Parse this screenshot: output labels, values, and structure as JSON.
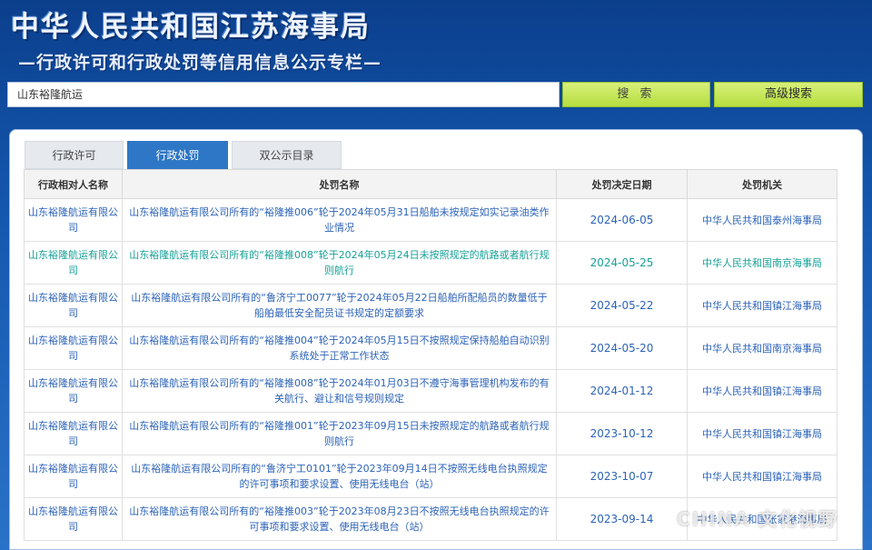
{
  "header": {
    "title": "中华人民共和国江苏海事局",
    "subtitle": "—行政许可和行政处罚等信用信息公示专栏—"
  },
  "search": {
    "value": "山东裕隆航运",
    "search_label": "搜 索",
    "advanced_label": "高级搜索"
  },
  "tabs": [
    {
      "label": "行政许可"
    },
    {
      "label": "行政处罚"
    },
    {
      "label": "双公示目录"
    }
  ],
  "table": {
    "headers": [
      "行政相对人名称",
      "处罚名称",
      "处罚决定日期",
      "处罚机关"
    ],
    "rows": [
      {
        "party": "山东裕隆航运有限公司",
        "name": "山东裕隆航运有限公司所有的“裕隆推006”轮于2024年05月31日船舶未按规定如实记录油类作业情况",
        "date": "2024-06-05",
        "agency": "中华人民共和国泰州海事局"
      },
      {
        "party": "山东裕隆航运有限公司",
        "name": "山东裕隆航运有限公司所有的“裕隆推008”轮于2024年05月24日未按照规定的航路或者航行规则航行",
        "date": "2024-05-25",
        "agency": "中华人民共和国南京海事局"
      },
      {
        "party": "山东裕隆航运有限公司",
        "name": "山东裕隆航运有限公司所有的“鲁济宁工0077”轮于2024年05月22日船舶所配船员的数量低于船舶最低安全配员证书规定的定额要求",
        "date": "2024-05-22",
        "agency": "中华人民共和国镇江海事局"
      },
      {
        "party": "山东裕隆航运有限公司",
        "name": "山东裕隆航运有限公司所有的“裕隆推004”轮于2024年05月15日不按照规定保持船舶自动识别系统处于正常工作状态",
        "date": "2024-05-20",
        "agency": "中华人民共和国南京海事局"
      },
      {
        "party": "山东裕隆航运有限公司",
        "name": "山东裕隆航运有限公司所有的“裕隆推008”轮于2024年01月03日不遵守海事管理机构发布的有关航行、避让和信号规则规定",
        "date": "2024-01-12",
        "agency": "中华人民共和国镇江海事局"
      },
      {
        "party": "山东裕隆航运有限公司",
        "name": "山东裕隆航运有限公司所有的“裕隆推001”轮于2023年09月15日未按照规定的航路或者航行规则航行",
        "date": "2023-10-12",
        "agency": "中华人民共和国镇江海事局"
      },
      {
        "party": "山东裕隆航运有限公司",
        "name": "山东裕隆航运有限公司所有的“鲁济宁工0101”轮于2023年09月14日不按照无线电台执照规定的许可事项和要求设置、使用无线电台（站）",
        "date": "2023-10-07",
        "agency": "中华人民共和国镇江海事局"
      },
      {
        "party": "山东裕隆航运有限公司",
        "name": "山东裕隆航运有限公司所有的“裕隆推003”轮于2023年08月23日不按照无线电台执照规定的许可事项和要求设置、使用无线电台（站）",
        "date": "2023-09-14",
        "agency": "中华人民共和国张家港海事局"
      }
    ]
  },
  "watermark": "CHINA 文化视野",
  "colors": {
    "header_bg": "#0b3f8c",
    "tab_active": "#2e77c6",
    "button": "#c6e75a",
    "link": "#2c63b8",
    "link_alt": "#17a197"
  }
}
